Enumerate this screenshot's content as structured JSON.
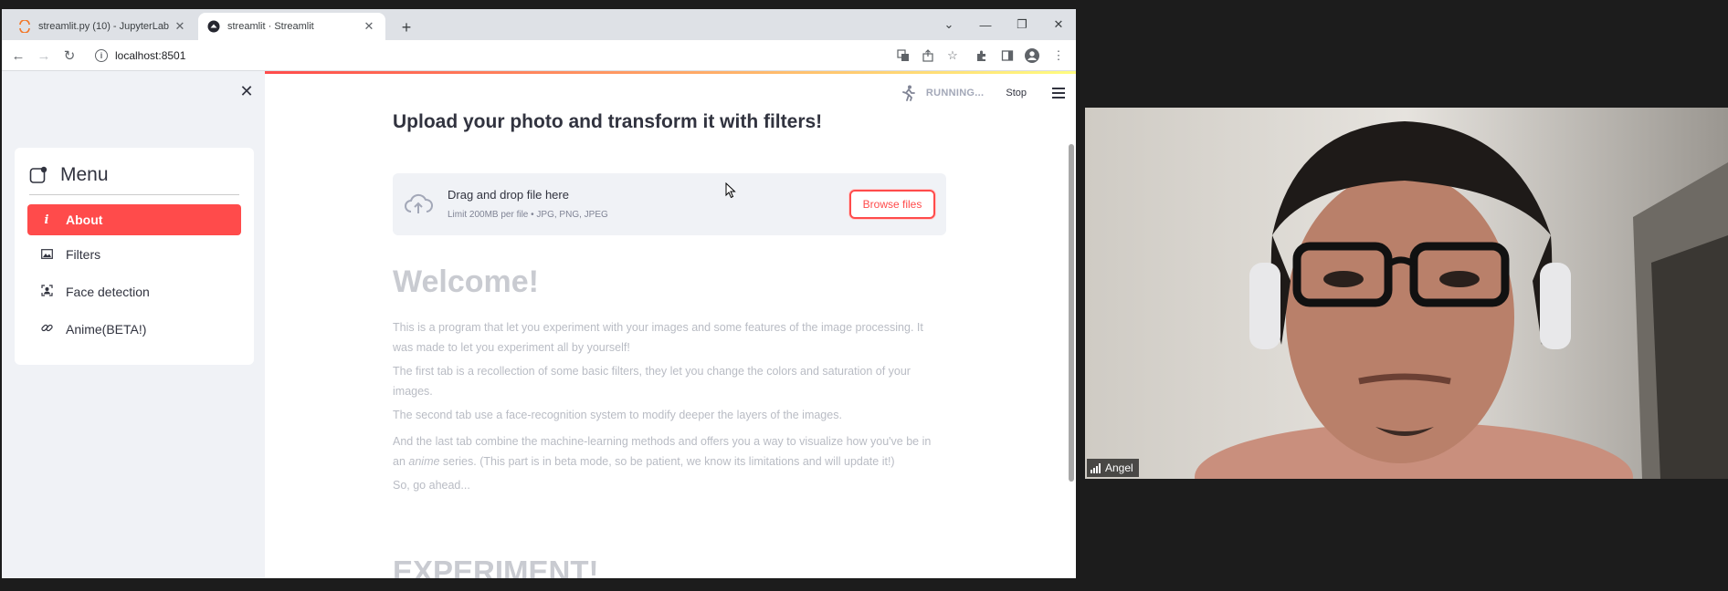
{
  "browser": {
    "tabs": [
      {
        "title": "streamlit.py (10) - JupyterLab",
        "active": false
      },
      {
        "title": "streamlit · Streamlit",
        "active": true
      }
    ],
    "url": "localhost:8501"
  },
  "status": {
    "running": "RUNNING...",
    "stop": "Stop"
  },
  "sidebar": {
    "menu_title": "Menu",
    "items": [
      {
        "label": "About",
        "icon": "info-icon",
        "selected": true
      },
      {
        "label": "Filters",
        "icon": "image-icon",
        "selected": false
      },
      {
        "label": "Face detection",
        "icon": "face-icon",
        "selected": false
      },
      {
        "label": "Anime(BETA!)",
        "icon": "link-icon",
        "selected": false
      }
    ]
  },
  "main": {
    "headline": "Upload your photo and transform it with filters!",
    "uploader": {
      "drag_text": "Drag and drop file here",
      "limit_text": "Limit 200MB per file • JPG, PNG, JPEG",
      "browse_label": "Browse files"
    },
    "welcome": "Welcome!",
    "paragraphs": [
      "This is a program that let you experiment with your images and some features of the image processing. It was made to let you experiment all by yourself!",
      "The first tab is a recollection of some basic filters, they let you change the colors and saturation of your images.",
      "The second tab use a face-recognition system to modify deeper the layers of the images.",
      "So, go ahead..."
    ],
    "para4": {
      "before": "And the last tab combine the machine-learning methods and offers you a way to visualize how you've be in an ",
      "em": "anime",
      "after": " series. (This part is in beta mode, so be patient, we know its limitations and will update it!)"
    },
    "experiment": "EXPERIMENT!"
  },
  "video": {
    "participant": "Angel"
  },
  "colors": {
    "accent": "#ff4b4b",
    "sidebar_bg": "#f0f2f6",
    "faded_text": "#b9bcc4"
  }
}
